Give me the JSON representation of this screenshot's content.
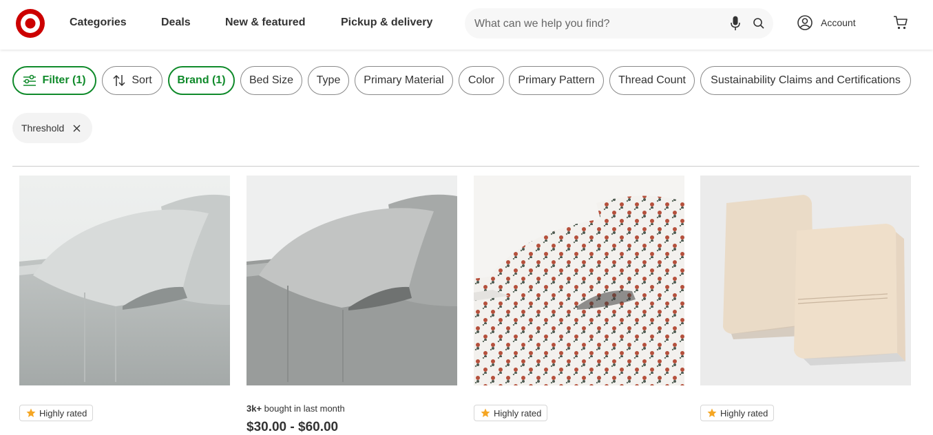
{
  "brand_color": "#cc0000",
  "accent_green": "#0f8a2a",
  "header": {
    "nav": [
      "Categories",
      "Deals",
      "New & featured",
      "Pickup & delivery"
    ],
    "search_placeholder": "What can we help you find?",
    "account_label": "Account"
  },
  "filters": {
    "filter_label": "Filter (1)",
    "sort_label": "Sort",
    "brand_label": "Brand (1)",
    "chips": [
      "Bed Size",
      "Type",
      "Primary Material",
      "Color",
      "Primary Pattern",
      "Thread Count",
      "Sustainability Claims and Certifications"
    ],
    "applied": {
      "label": "Threshold"
    }
  },
  "products": [
    {
      "badge": "Highly rated",
      "image": "gray-sheet-set"
    },
    {
      "bought_count": "3k+",
      "bought_text": " bought in last month",
      "price": "$30.00 - $60.00",
      "image": "heather-gray-sheet-set"
    },
    {
      "badge": "Highly rated",
      "image": "floral-print-sheet-set"
    },
    {
      "badge": "Highly rated",
      "image": "cream-pillowcases"
    }
  ]
}
